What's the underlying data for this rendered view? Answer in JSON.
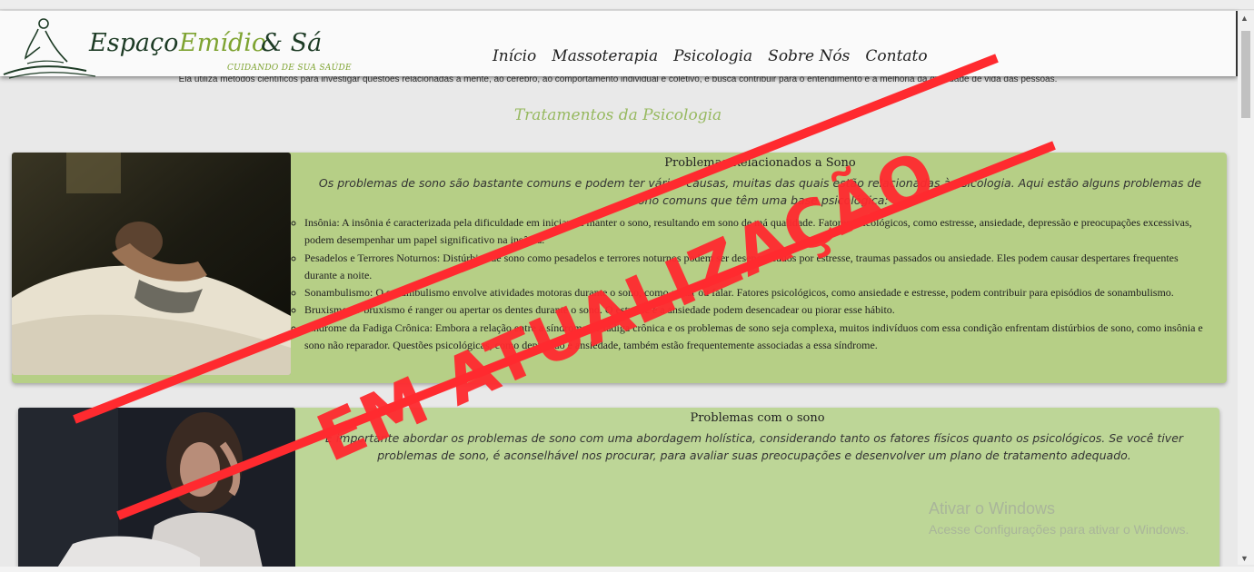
{
  "brand": {
    "part1": "Espaço ",
    "part2": "Emídio",
    "part3": " & Sá",
    "tagline": "CUIDANDO DE SUA SAÚDE"
  },
  "nav": [
    "Início",
    "Massoterapia",
    "Psicologia",
    "Sobre Nós",
    "Contato"
  ],
  "subtext": "Ela utiliza métodos científicos para investigar questões relacionadas à mente, ao cérebro, ao comportamento individual e coletivo, e busca contribuir para o entendimento e a melhoria da qualidade de vida das pessoas.",
  "section_title": "Tratamentos da Psicologia",
  "card1": {
    "title": "Problemas Relacionados a Sono",
    "intro": "Os problemas de sono são bastante comuns e podem ter várias causas, muitas das quais estão relacionadas à psicologia. Aqui estão alguns problemas de sono comuns que têm uma base psicológica:",
    "items": [
      "Insônia: A insônia é caracterizada pela dificuldade em iniciar ou manter o sono, resultando em sono de má qualidade. Fatores psicológicos, como estresse, ansiedade, depressão e preocupações excessivas, podem desempenhar um papel significativo na insônia.",
      "Pesadelos e Terrores Noturnos: Distúrbios de sono como pesadelos e terrores noturnos podem ser desencadeados por estresse, traumas passados ou ansiedade. Eles podem causar despertares frequentes durante a noite.",
      "Sonambulismo: O sonambulismo envolve atividades motoras durante o sono, como andar ou falar. Fatores psicológicos, como ansiedade e estresse, podem contribuir para episódios de sonambulismo.",
      "Bruxismo: O bruxismo é ranger ou apertar os dentes durante o sono. O estresse e a ansiedade podem desencadear ou piorar esse hábito.",
      "Síndrome da Fadiga Crônica: Embora a relação entre a síndrome de fadiga crônica e os problemas de sono seja complexa, muitos indivíduos com essa condição enfrentam distúrbios de sono, como insônia e sono não reparador. Questões psicológicas, como depressão e ansiedade, também estão frequentemente associadas a essa síndrome."
    ]
  },
  "card2": {
    "title": "Problemas com o sono",
    "intro": "É importante abordar os problemas de sono com uma abordagem holística, considerando tanto os fatores físicos quanto os psicológicos. Se você tiver problemas de sono, é aconselhável nos procurar, para avaliar suas preocupações e desenvolver um plano de tratamento adequado."
  },
  "watermark": {
    "line1": "Ativar o Windows",
    "line2": "Acesse Configurações para ativar o Windows."
  },
  "stamp": "EM ATUALIZAÇÃO",
  "colors": {
    "card": "#b6cf86",
    "accent": "#97b960",
    "stamp": "#ff2a2f",
    "brand_dark": "#1d3b25"
  }
}
